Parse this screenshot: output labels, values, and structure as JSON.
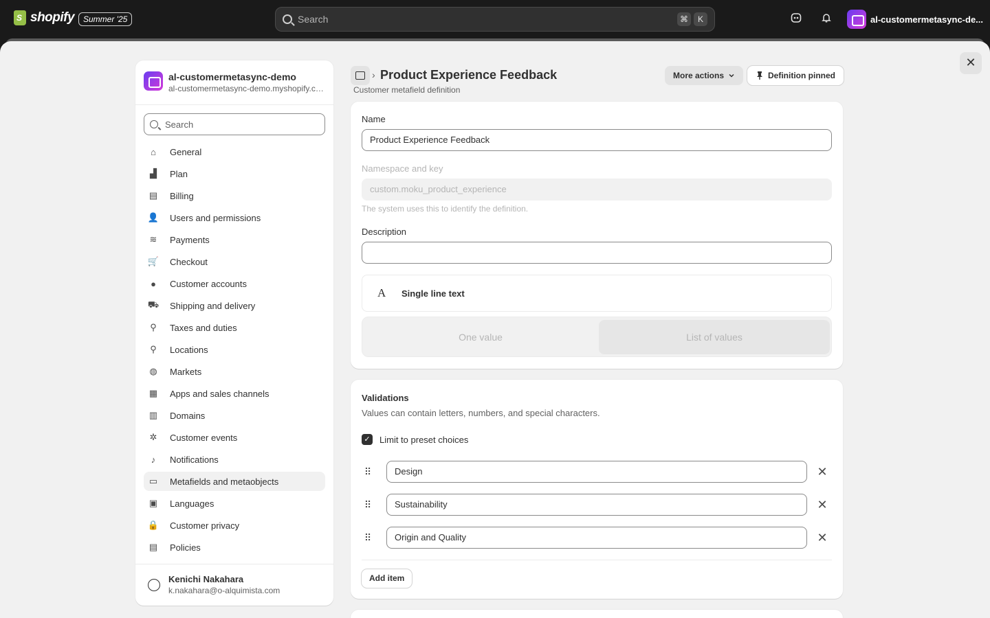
{
  "topbar": {
    "logo_text": "shopify",
    "edition_badge": "Summer '25",
    "search_placeholder": "Search",
    "shortcut_keys": [
      "⌘",
      "K"
    ],
    "store_name": "al-customermetasync-de..."
  },
  "sidebar": {
    "store_name": "al-customermetasync-demo",
    "store_url": "al-customermetasync-demo.myshopify.com",
    "search_placeholder": "Search",
    "items": [
      {
        "label": "General",
        "icon": "store-icon"
      },
      {
        "label": "Plan",
        "icon": "plan-icon"
      },
      {
        "label": "Billing",
        "icon": "receipt-icon"
      },
      {
        "label": "Users and permissions",
        "icon": "users-icon"
      },
      {
        "label": "Payments",
        "icon": "payments-icon"
      },
      {
        "label": "Checkout",
        "icon": "cart-icon"
      },
      {
        "label": "Customer accounts",
        "icon": "person-icon"
      },
      {
        "label": "Shipping and delivery",
        "icon": "truck-icon"
      },
      {
        "label": "Taxes and duties",
        "icon": "tax-icon"
      },
      {
        "label": "Locations",
        "icon": "location-icon"
      },
      {
        "label": "Markets",
        "icon": "globe-icon"
      },
      {
        "label": "Apps and sales channels",
        "icon": "apps-icon"
      },
      {
        "label": "Domains",
        "icon": "domain-icon"
      },
      {
        "label": "Customer events",
        "icon": "cursor-icon"
      },
      {
        "label": "Notifications",
        "icon": "bell-icon"
      },
      {
        "label": "Metafields and metaobjects",
        "icon": "metafield-icon",
        "active": true
      },
      {
        "label": "Languages",
        "icon": "language-icon"
      },
      {
        "label": "Customer privacy",
        "icon": "lock-icon"
      },
      {
        "label": "Policies",
        "icon": "policy-icon"
      }
    ],
    "user_name": "Kenichi Nakahara",
    "user_email": "k.nakahara@o-alquimista.com"
  },
  "header": {
    "title": "Product Experience Feedback",
    "subtitle": "Customer metafield definition",
    "more_actions": "More actions",
    "pinned": "Definition pinned"
  },
  "definition": {
    "name_label": "Name",
    "name_value": "Product Experience Feedback",
    "ns_label": "Namespace and key",
    "ns_value": "custom.moku_product_experience",
    "ns_help": "The system uses this to identify the definition.",
    "description_label": "Description",
    "description_value": "",
    "type_glyph": "A",
    "type_label": "Single line text",
    "one_value": "One value",
    "list_values": "List of values"
  },
  "validations": {
    "title": "Validations",
    "description": "Values can contain letters, numbers, and special characters.",
    "limit_label": "Limit to preset choices",
    "limit_checked": true,
    "choices": [
      "Design",
      "Sustainability",
      "Origin and Quality"
    ],
    "add_item": "Add item"
  }
}
